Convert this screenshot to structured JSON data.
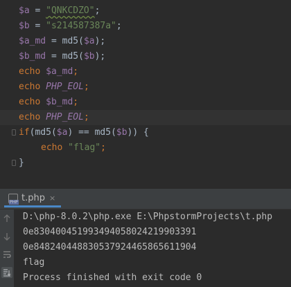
{
  "editor": {
    "lines": [
      {
        "tokens": [
          [
            "var",
            "$a"
          ],
          [
            "op",
            " = "
          ],
          [
            "str",
            "\"QNKCDZO\""
          ],
          [
            "op",
            ";"
          ]
        ]
      },
      {
        "tokens": [
          [
            "var",
            "$b"
          ],
          [
            "op",
            " = "
          ],
          [
            "str",
            "\"s214587387a\""
          ],
          [
            "op",
            ";"
          ]
        ]
      },
      {
        "tokens": [
          [
            "var",
            "$a_md"
          ],
          [
            "op",
            " = "
          ],
          [
            "fn",
            "md5("
          ],
          [
            "var",
            "$a"
          ],
          [
            "fn",
            ")"
          ],
          [
            "op",
            ";"
          ]
        ]
      },
      {
        "tokens": [
          [
            "var",
            "$b_md"
          ],
          [
            "op",
            " = "
          ],
          [
            "fn",
            "md5("
          ],
          [
            "var",
            "$b"
          ],
          [
            "fn",
            ")"
          ],
          [
            "op",
            ";"
          ]
        ]
      },
      {
        "tokens": [
          [
            "kw",
            "echo "
          ],
          [
            "var",
            "$a_md"
          ],
          [
            "kw",
            ";"
          ]
        ]
      },
      {
        "tokens": [
          [
            "kw",
            "echo "
          ],
          [
            "const",
            "PHP_EOL"
          ],
          [
            "kw",
            ";"
          ]
        ]
      },
      {
        "tokens": [
          [
            "kw",
            "echo "
          ],
          [
            "var",
            "$b_md"
          ],
          [
            "kw",
            ";"
          ]
        ]
      },
      {
        "tokens": [
          [
            "kw",
            "echo "
          ],
          [
            "const",
            "PHP_EOL"
          ],
          [
            "kw",
            ";"
          ]
        ]
      },
      {
        "tokens": [
          [
            "kw",
            "if"
          ],
          [
            "op",
            "(md5("
          ],
          [
            "var",
            "$a"
          ],
          [
            "op",
            ") == md5("
          ],
          [
            "var",
            "$b"
          ],
          [
            "op",
            ")) {"
          ]
        ]
      },
      {
        "tokens": [
          [
            "kw",
            "echo "
          ],
          [
            "str",
            "\"flag\""
          ],
          [
            "kw",
            ";"
          ]
        ]
      },
      {
        "tokens": [
          [
            "op",
            "}"
          ]
        ]
      }
    ]
  },
  "run_panel": {
    "tab_label": "t.php",
    "tab_icon": "php-file-icon",
    "tab_icon_text": "PHP",
    "close_glyph": "×",
    "output": [
      "D:\\php-8.0.2\\php.exe E:\\PhpstormProjects\\t.php",
      "0e830400451993494058024219903391",
      "0e848240448830537924465865611904",
      "flag",
      "Process finished with exit code 0"
    ]
  },
  "colors": {
    "background": "#2b2b2b",
    "variable": "#9876aa",
    "string": "#6a8759",
    "keyword": "#cc7832",
    "text": "#a9b7c6",
    "tab_underline": "#4a88c7"
  }
}
